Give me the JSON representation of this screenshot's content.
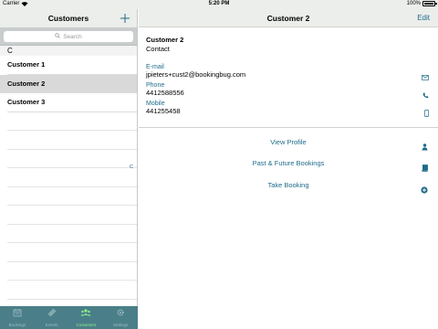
{
  "status_bar": {
    "carrier": "Carrier",
    "time": "5:20 PM",
    "battery": "100%"
  },
  "left": {
    "title": "Customers",
    "search_placeholder": "Search",
    "section": "C",
    "rows": [
      "Customer 1",
      "Customer 2",
      "Customer 3"
    ],
    "selected_index": 1,
    "index_letter": "C"
  },
  "tabs": [
    {
      "label": "Bookings",
      "icon": "calendar-icon"
    },
    {
      "label": "Events",
      "icon": "ticket-icon"
    },
    {
      "label": "Customers",
      "icon": "people-icon",
      "active": true
    },
    {
      "label": "Settings",
      "icon": "gear-icon"
    }
  ],
  "right": {
    "title": "Customer 2",
    "edit_label": "Edit",
    "name": "Customer 2",
    "type": "Contact",
    "email_label": "E-mail",
    "email": "jpieters+cust2@bookingbug.com",
    "phone_label": "Phone",
    "phone": "4412588556",
    "mobile_label": "Mobile",
    "mobile": "441255458",
    "actions": [
      "View Profile",
      "Past & Future Bookings",
      "Take Booking"
    ]
  },
  "colors": {
    "accent": "#1f6b8a",
    "tab_bar": "#4a7f89",
    "tab_active": "#8ff08a",
    "nav_bg": "#ebeeea"
  }
}
